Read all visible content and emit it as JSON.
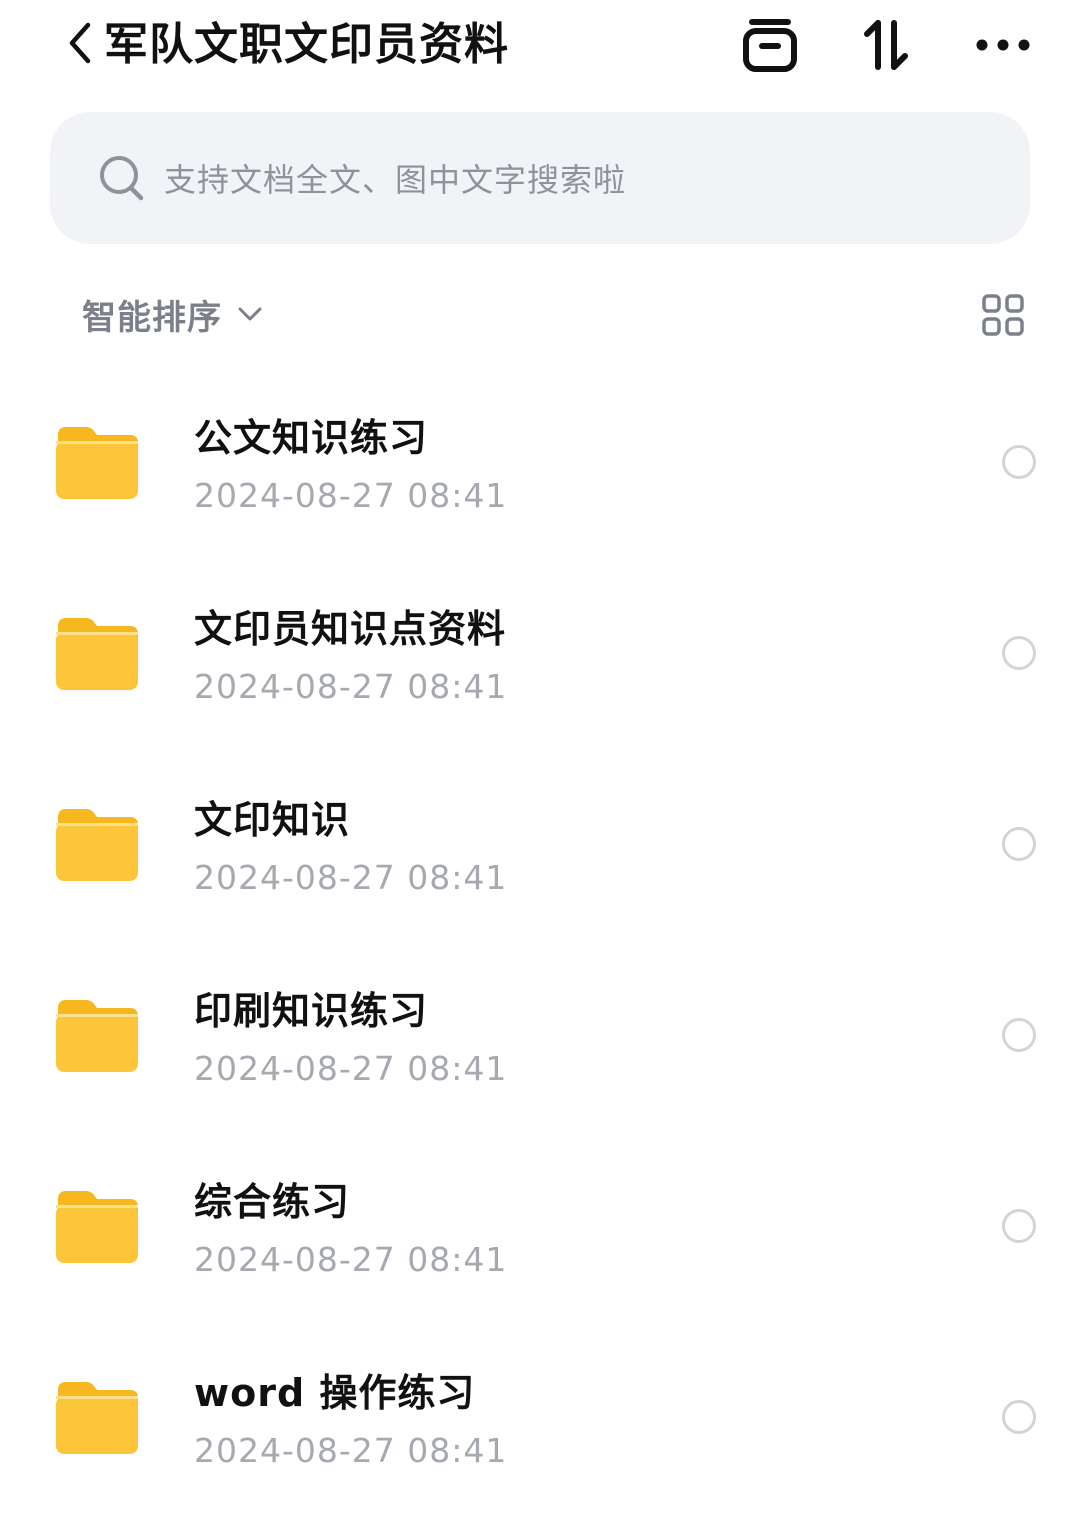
{
  "header": {
    "title": "军队文职文印员资料",
    "icons": [
      "back-icon",
      "archive-box-icon",
      "sort-arrows-icon",
      "more-dots-icon"
    ]
  },
  "search": {
    "placeholder": "支持文档全文、图中文字搜索啦"
  },
  "sort": {
    "label": "智能排序"
  },
  "items": [
    {
      "name": "公文知识练习",
      "date": "2024-08-27 08:41",
      "selected": false
    },
    {
      "name": "文印员知识点资料",
      "date": "2024-08-27 08:41",
      "selected": false
    },
    {
      "name": "文印知识",
      "date": "2024-08-27 08:41",
      "selected": false
    },
    {
      "name": "印刷知识练习",
      "date": "2024-08-27 08:41",
      "selected": false
    },
    {
      "name": "综合练习",
      "date": "2024-08-27 08:41",
      "selected": false
    },
    {
      "name": "word 操作练习",
      "date": "2024-08-27 08:41",
      "selected": false
    }
  ],
  "colors": {
    "folder": "#fdc63a",
    "folder_tab": "#f7b81f",
    "search_bg": "#f2f3f7",
    "muted_text": "#a6a9b0"
  }
}
